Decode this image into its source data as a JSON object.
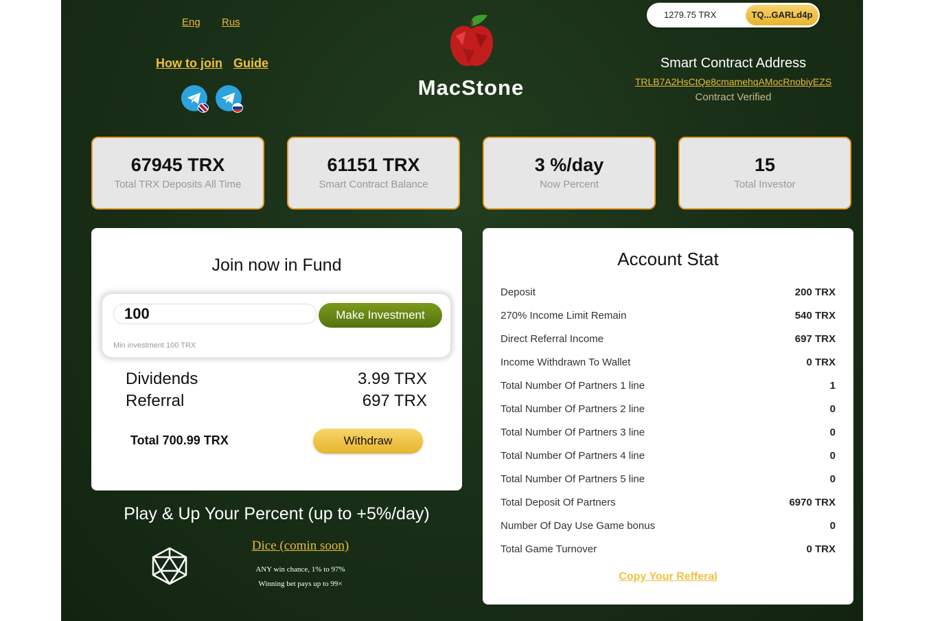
{
  "header": {
    "lang_eng": "Eng",
    "lang_rus": "Rus",
    "how_to_join": "How to join",
    "guide": "Guide",
    "brand": "MacStone",
    "wallet_balance": "1279.75 TRX",
    "wallet_address": "TQ...GARLd4p",
    "contract_title": "Smart Contract Address",
    "contract_address": "TRLB7A2HsCtQe8cmamehqAMocRnobiyEZS",
    "contract_status": "Contract Verified",
    "icons": [
      "telegram-icon",
      "uk-flag-icon",
      "ru-flag-icon",
      "apple-logo-icon"
    ]
  },
  "stats": [
    {
      "value": "67945 TRX",
      "label": "Total TRX Deposits All Time"
    },
    {
      "value": "61151 TRX",
      "label": "Smart Contract Balance"
    },
    {
      "value": "3 %/day",
      "label": "Now Percent"
    },
    {
      "value": "15",
      "label": "Total Investor"
    }
  ],
  "join": {
    "title": "Join now in Fund",
    "amount": "100",
    "button": "Make Investment",
    "min_note": "Min investment 100 TRX",
    "dividends_label": "Dividends",
    "dividends_value": "3.99 TRX",
    "referral_label": "Referral",
    "referral_value": "697 TRX",
    "total": "Total 700.99 TRX",
    "withdraw": "Withdraw"
  },
  "play": {
    "title": "Play & Up Your Percent (up to +5%/day)",
    "dice_link": "Dice (comin soon)",
    "line1": "ANY win chance, 1% to 97%",
    "line2": "Winning bet pays up to 99×",
    "icon": "dice-icon"
  },
  "account": {
    "title": "Account Stat",
    "rows": [
      {
        "k": "Deposit",
        "v": "200 TRX"
      },
      {
        "k": "270% Income Limit Remain",
        "v": "540 TRX"
      },
      {
        "k": "Direct Referral Income",
        "v": "697 TRX"
      },
      {
        "k": "Income Withdrawn To Wallet",
        "v": "0 TRX"
      },
      {
        "k": "Total Number Of Partners 1 line",
        "v": "1"
      },
      {
        "k": "Total Number Of Partners 2 line",
        "v": "0"
      },
      {
        "k": "Total Number Of Partners 3 line",
        "v": "0"
      },
      {
        "k": "Total Number Of Partners 4 line",
        "v": "0"
      },
      {
        "k": "Total Number Of Partners 5 line",
        "v": "0"
      },
      {
        "k": "Total Deposit Of Partners",
        "v": "6970 TRX"
      },
      {
        "k": "Number Of Day Use Game bonus",
        "v": "0"
      },
      {
        "k": "Total Game Turnover",
        "v": "0 TRX"
      }
    ],
    "copy_ref": "Copy Your Refferal"
  },
  "colors": {
    "accent": "#e8b93a",
    "card_border": "#e89b2a",
    "button_green": "#6b8a17",
    "background": "#1a3018"
  }
}
